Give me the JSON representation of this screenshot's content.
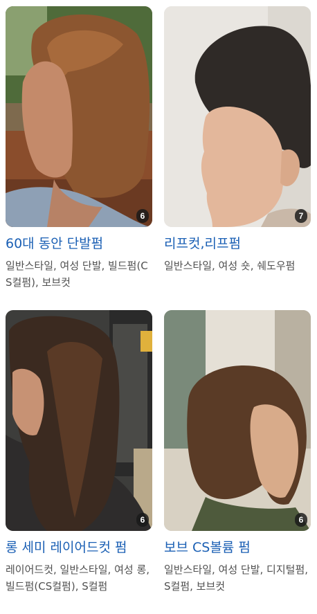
{
  "styles": [
    {
      "title": "60대 동안 단발펌",
      "description": "일반스타일, 여성 단발, 빌드펌(CS컬펌), 보브컷",
      "photo_count": "6"
    },
    {
      "title": "리프컷,리프펌",
      "description": "일반스타일, 여성 숏, 쉐도우펌",
      "photo_count": "7"
    },
    {
      "title": "롱 세미 레이어드컷 펌",
      "description": "레이어드컷, 일반스타일, 여성 롱, 빌드펌(CS컬펌), S컬펌",
      "photo_count": "6"
    },
    {
      "title": "보브 CS볼륨 펌",
      "description": "일반스타일, 여성 단발, 디지털펌, S컬펌, 보브컷",
      "photo_count": "6"
    }
  ],
  "colors": {
    "title": "#1a5fb4",
    "description": "#505050",
    "badge_bg": "#191919"
  }
}
